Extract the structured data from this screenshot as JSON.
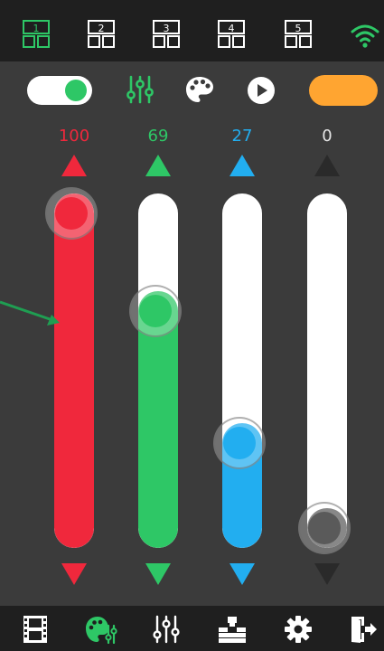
{
  "presets": [
    {
      "label": "1",
      "active": true
    },
    {
      "label": "2",
      "active": false
    },
    {
      "label": "3",
      "active": false
    },
    {
      "label": "4",
      "active": false
    },
    {
      "label": "5",
      "active": false
    }
  ],
  "status": {
    "wifi_icon": "wifi-icon",
    "wifi_color": "#2ec766"
  },
  "controls": {
    "power_toggle": {
      "on": true,
      "color": "#2ec766"
    },
    "icons": [
      "sliders-icon",
      "palette-icon",
      "play-icon"
    ],
    "active_color": "#ffa531"
  },
  "channels": [
    {
      "name": "red",
      "value": "100",
      "level": 1.0,
      "color": "#f0283c"
    },
    {
      "name": "green",
      "value": "69",
      "level": 0.69,
      "color": "#2ec766"
    },
    {
      "name": "blue",
      "value": "27",
      "level": 0.27,
      "color": "#22aef0"
    },
    {
      "name": "white",
      "value": "0",
      "level": 0.0,
      "color": "#5a5a5a"
    }
  ],
  "bottom_nav": [
    {
      "icon": "film-icon",
      "active": false
    },
    {
      "icon": "palette-icon",
      "active": true
    },
    {
      "icon": "sliders-icon",
      "active": false
    },
    {
      "icon": "sort-icon",
      "active": false
    },
    {
      "icon": "gear-icon",
      "active": false
    },
    {
      "icon": "exit-icon",
      "active": false
    }
  ],
  "accent_green": "#2ec766",
  "inactive_icon": "#ffffff"
}
